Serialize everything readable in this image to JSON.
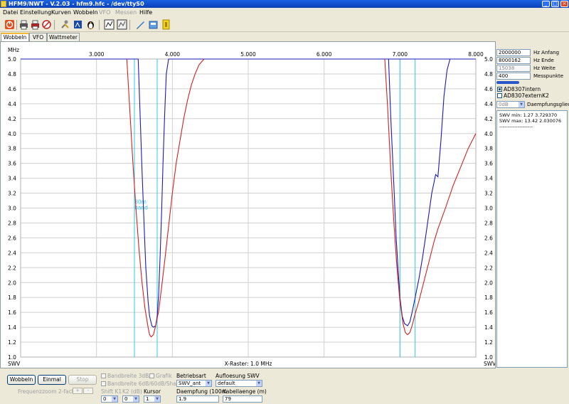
{
  "window": {
    "title": "HFM9/NWT - V.2.03 - hfm9.hfc - /dev/ttyS0",
    "controls": [
      "_",
      "□",
      "×"
    ]
  },
  "menu": [
    {
      "label": "Datei",
      "disabled": false
    },
    {
      "label": "Einstellung",
      "disabled": false
    },
    {
      "label": "Kurven",
      "disabled": false
    },
    {
      "label": "Wobbeln",
      "disabled": false
    },
    {
      "label": "VFO",
      "disabled": true
    },
    {
      "label": "Messen",
      "disabled": true
    },
    {
      "label": "Hilfe",
      "disabled": false
    }
  ],
  "toolbar_icons": [
    "power-icon",
    "printer-icon",
    "printer-color-icon",
    "eraser-icon",
    "tools-icon",
    "calibrate-icon",
    "penguin-icon",
    "screenshot-icon",
    "screenshot2-icon",
    "save-icon",
    "open-icon",
    "info-icon"
  ],
  "tabs": [
    {
      "label": "Wobbeln",
      "active": true
    },
    {
      "label": "VFO",
      "active": false
    },
    {
      "label": "Wattmeter",
      "active": false
    }
  ],
  "chart_data": {
    "type": "line",
    "xlabel": "X-Raster: 1.0 MHz",
    "x_unit": "MHz",
    "y_label_left": "SWV",
    "y_label_right": "SWV",
    "xlim": [
      2.0,
      8.0
    ],
    "ylim": [
      1.0,
      5.0
    ],
    "x_ticks": [
      {
        "value": 3.0,
        "label": "3.000"
      },
      {
        "value": 4.0,
        "label": "4.000"
      },
      {
        "value": 5.0,
        "label": "5.000"
      },
      {
        "value": 6.0,
        "label": "6.000"
      },
      {
        "value": 7.0,
        "label": "7.000"
      },
      {
        "value": 8.0,
        "label": "8.000"
      }
    ],
    "y_ticks": [
      "1.0",
      "1.2",
      "1.4",
      "1.6",
      "1.8",
      "2.0",
      "2.2",
      "2.4",
      "2.6",
      "2.8",
      "3.0",
      "3.2",
      "3.4",
      "3.6",
      "3.8",
      "4.0",
      "4.2",
      "4.4",
      "4.6",
      "4.8",
      "5.0"
    ],
    "grid": true,
    "band_markers": [
      3.5,
      3.8,
      7.0,
      7.2
    ],
    "band_label": {
      "text": [
        "80m",
        "band"
      ],
      "x": 3.52,
      "y": 3.0
    },
    "series": [
      {
        "color": "#1a1ab8",
        "x": [
          2.0,
          3.55,
          3.6,
          3.63,
          3.65,
          3.68,
          3.7,
          3.73,
          3.75,
          3.78,
          3.8,
          3.82,
          3.84,
          3.86,
          3.88,
          3.9,
          3.92,
          3.95,
          8.0
        ],
        "y": [
          5.0,
          5.0,
          3.5,
          2.7,
          2.2,
          1.75,
          1.55,
          1.42,
          1.4,
          1.42,
          1.55,
          1.85,
          2.4,
          3.0,
          3.7,
          4.3,
          4.8,
          5.0,
          5.0
        ],
        "segments": [
          {
            "x": [
              6.8,
              6.85,
              6.88,
              6.92,
              6.95,
              6.98,
              7.0,
              7.03,
              7.06,
              7.1,
              7.13,
              7.16,
              7.2,
              7.25,
              7.3,
              7.35,
              7.42,
              7.47,
              7.5,
              7.54,
              7.58,
              7.62,
              7.66,
              8.0
            ],
            "y": [
              5.0,
              5.0,
              4.2,
              3.3,
              2.6,
              2.1,
              1.8,
              1.55,
              1.45,
              1.42,
              1.47,
              1.6,
              1.8,
              2.05,
              2.35,
              2.7,
              3.2,
              3.45,
              3.42,
              3.9,
              4.5,
              4.85,
              5.0,
              5.0
            ]
          }
        ]
      },
      {
        "color": "#d42020",
        "x": [
          3.4,
          3.44,
          3.48,
          3.52,
          3.56,
          3.6,
          3.64,
          3.68,
          3.7,
          3.72,
          3.75,
          3.78,
          3.82,
          3.86,
          3.9,
          3.95,
          4.0,
          4.05,
          4.1,
          4.15,
          4.2,
          4.25,
          4.3,
          4.35,
          4.4,
          4.42
        ],
        "y": [
          5.0,
          4.3,
          3.6,
          3.0,
          2.45,
          2.0,
          1.65,
          1.4,
          1.3,
          1.27,
          1.3,
          1.42,
          1.62,
          1.95,
          2.3,
          2.75,
          3.2,
          3.6,
          3.9,
          4.2,
          4.45,
          4.65,
          4.8,
          4.92,
          4.98,
          5.0
        ],
        "segments": [
          {
            "x": [
              6.8,
              6.84,
              6.88,
              6.92,
              6.96,
              7.0,
              7.04,
              7.07,
              7.1,
              7.13,
              7.16,
              7.2,
              7.25,
              7.3,
              7.35,
              7.4,
              7.45,
              7.5,
              7.6,
              7.7,
              7.8,
              7.9,
              8.0
            ],
            "y": [
              5.0,
              4.3,
              3.5,
              2.8,
              2.2,
              1.75,
              1.45,
              1.33,
              1.3,
              1.33,
              1.42,
              1.58,
              1.75,
              1.95,
              2.15,
              2.35,
              2.55,
              2.72,
              3.0,
              3.3,
              3.55,
              3.8,
              4.0
            ]
          }
        ]
      }
    ]
  },
  "side_panel": {
    "fields": [
      {
        "value": "2000000",
        "label": "Hz Anfang",
        "disabled": false
      },
      {
        "value": "8000162",
        "label": "Hz Ende",
        "disabled": false
      },
      {
        "value": "15038",
        "label": "Hz Weite",
        "disabled": true
      },
      {
        "value": "400",
        "label": "Messpunkte",
        "disabled": false
      }
    ],
    "probes": [
      {
        "label": "AD8307intern",
        "checked": true
      },
      {
        "label": "AD8307externK2",
        "checked": false
      }
    ],
    "attenuator": {
      "value": "0dB",
      "label": "Daempfungsglied"
    },
    "info_lines": [
      "SWV min: 1.27  3.729370",
      "SWV max: 13.42  2.030076",
      "--------------------"
    ]
  },
  "bottom": {
    "buttons": {
      "wobbeln": "Wobbeln",
      "einmal": "Einmal",
      "stop": "Stop"
    },
    "zoom_label": "Frequenzzoom 2-fach",
    "zoom_plus": "+",
    "zoom_minus": "-",
    "checks": {
      "bw3db": "Bandbreite 3dB/Q",
      "grafik": "Grafik",
      "bw6db": "Bandbreite 6dB/60dB/Shape"
    },
    "shift_label": "Shift K1",
    "k2_label": "K2 (dB)",
    "kursor_label": "Kursor",
    "shift_value": "0",
    "k2_value": "0",
    "kursor_value": "1",
    "betriebsart_label": "Betriebsart",
    "betriebsart_value": "SWV_ant",
    "aufloesung_label": "Aufloesung SWV",
    "aufloesung_value": "default",
    "daempfung_label": "Daempfung (100m",
    "daempfung_value": "1.9",
    "kabel_label": "Kabellaenge (m)",
    "kabel_value": "79"
  }
}
